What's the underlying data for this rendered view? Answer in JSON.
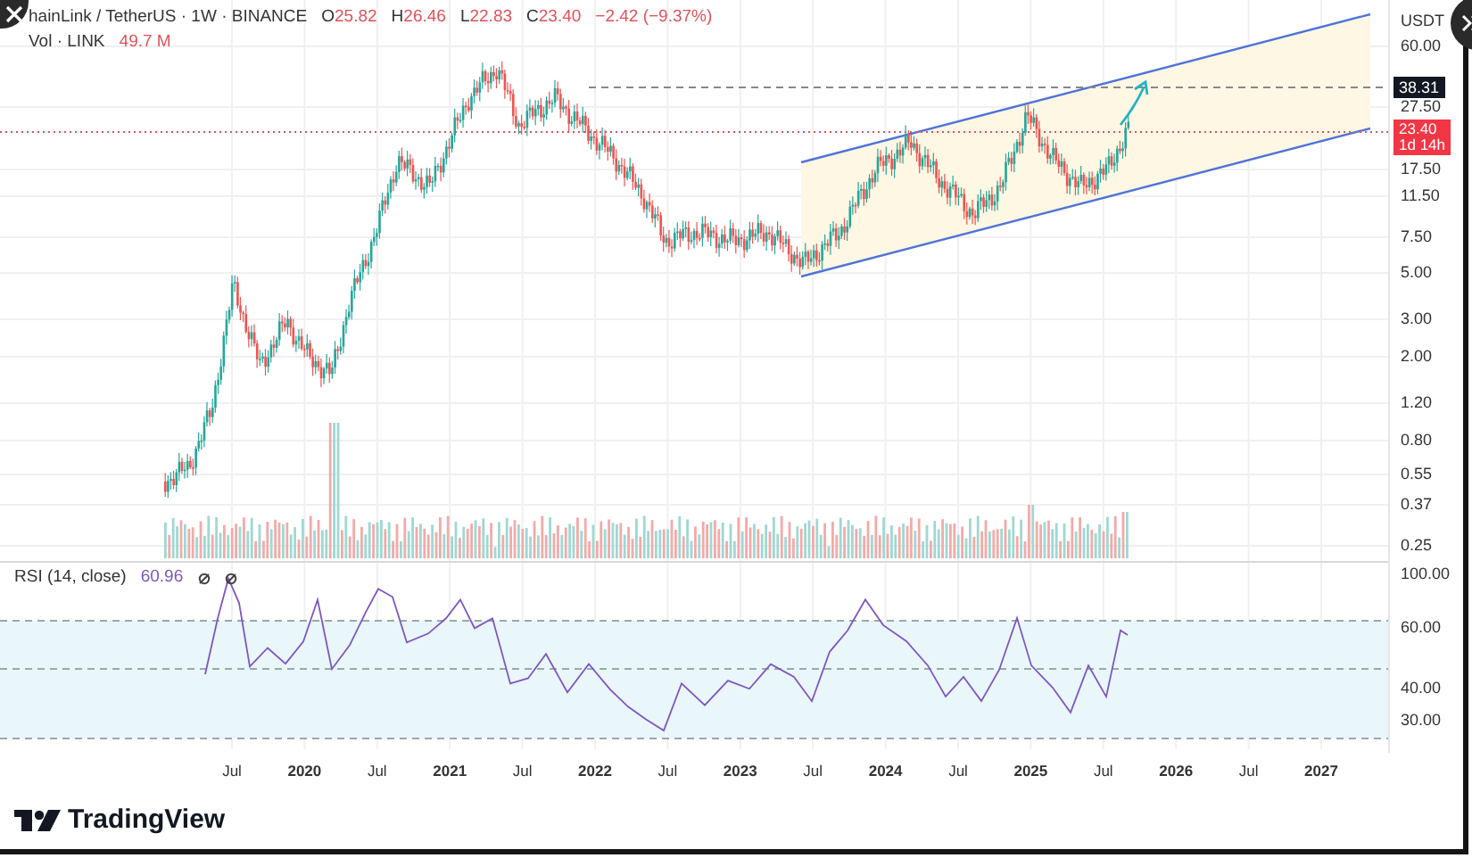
{
  "chart": {
    "symbol": "hainLink / TetherUS · 1W · BINANCE",
    "ohlc": [
      {
        "label": "O",
        "value": "25.82"
      },
      {
        "label": "H",
        "value": "26.46"
      },
      {
        "label": "L",
        "value": "22.83"
      },
      {
        "label": "C",
        "value": "23.40"
      }
    ],
    "change": "−2.42 (−9.37%)",
    "volume": {
      "label": "Vol · LINK",
      "value": "49.7 M"
    },
    "price_axis": {
      "currency": "USDT",
      "ticks": [
        "60.00",
        "27.50",
        "17.50",
        "11.50",
        "7.50",
        "5.00",
        "3.00",
        "2.00",
        "1.20",
        "0.80",
        "0.55",
        "0.37",
        "0.25"
      ],
      "target_price": "38.31",
      "last_price": "23.40",
      "countdown": "1d 14h"
    },
    "rsi": {
      "label": "RSI (14, close)",
      "value": "60.96",
      "ticks": [
        "100.00",
        "60.00",
        "40.00",
        "30.00"
      ]
    },
    "time_axis": [
      {
        "label": "Jul",
        "major": false
      },
      {
        "label": "2020",
        "major": true
      },
      {
        "label": "Jul",
        "major": false
      },
      {
        "label": "2021",
        "major": true
      },
      {
        "label": "Jul",
        "major": false
      },
      {
        "label": "2022",
        "major": true
      },
      {
        "label": "Jul",
        "major": false
      },
      {
        "label": "2023",
        "major": true
      },
      {
        "label": "Jul",
        "major": false
      },
      {
        "label": "2024",
        "major": true
      },
      {
        "label": "Jul",
        "major": false
      },
      {
        "label": "2025",
        "major": true
      },
      {
        "label": "Jul",
        "major": false
      },
      {
        "label": "2026",
        "major": true
      },
      {
        "label": "Jul",
        "major": false
      },
      {
        "label": "2027",
        "major": true
      }
    ]
  },
  "brand": "TradingView"
}
